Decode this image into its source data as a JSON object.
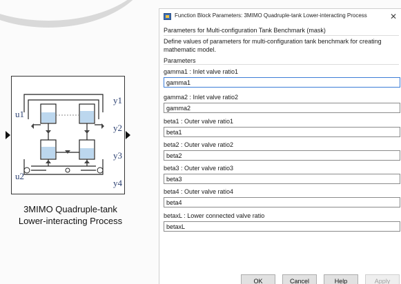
{
  "block": {
    "inputs": [
      "u1",
      "u2"
    ],
    "outputs": [
      "y1",
      "y2",
      "y3",
      "y4"
    ],
    "caption_line1": "3MIMO Quadruple-tank",
    "caption_line2": "Lower-interacting Process"
  },
  "dialog": {
    "title": "Function Block Parameters: 3MIMO Quadruple-tank Lower-interacting Process",
    "close_glyph": "✕",
    "mask_title": "Parameters for Multi-configuration Tank Benchmark (mask)",
    "description": "Define values of parameters for multi-configuration tank benchmark for creating mathematic model.",
    "section": "Parameters",
    "params": [
      {
        "label": "gamma1 : Inlet valve ratio1",
        "value": "gamma1"
      },
      {
        "label": "gamma2 : Inlet valve ratio2",
        "value": "gamma2"
      },
      {
        "label": "beta1 : Outer valve ratio1",
        "value": "beta1"
      },
      {
        "label": "beta2 : Outer valve ratio2",
        "value": "beta2"
      },
      {
        "label": "beta3 : Outer valve ratio3",
        "value": "beta3"
      },
      {
        "label": "beta4 : Outer valve ratio4",
        "value": "beta4"
      },
      {
        "label": "betaxL : Lower connected valve ratio",
        "value": "betaxL"
      }
    ],
    "buttons": {
      "ok": "OK",
      "cancel": "Cancel",
      "help": "Help",
      "apply": "Apply"
    }
  },
  "colors": {
    "port_label": "#2a3f70",
    "focus_border": "#3b7cd6"
  }
}
